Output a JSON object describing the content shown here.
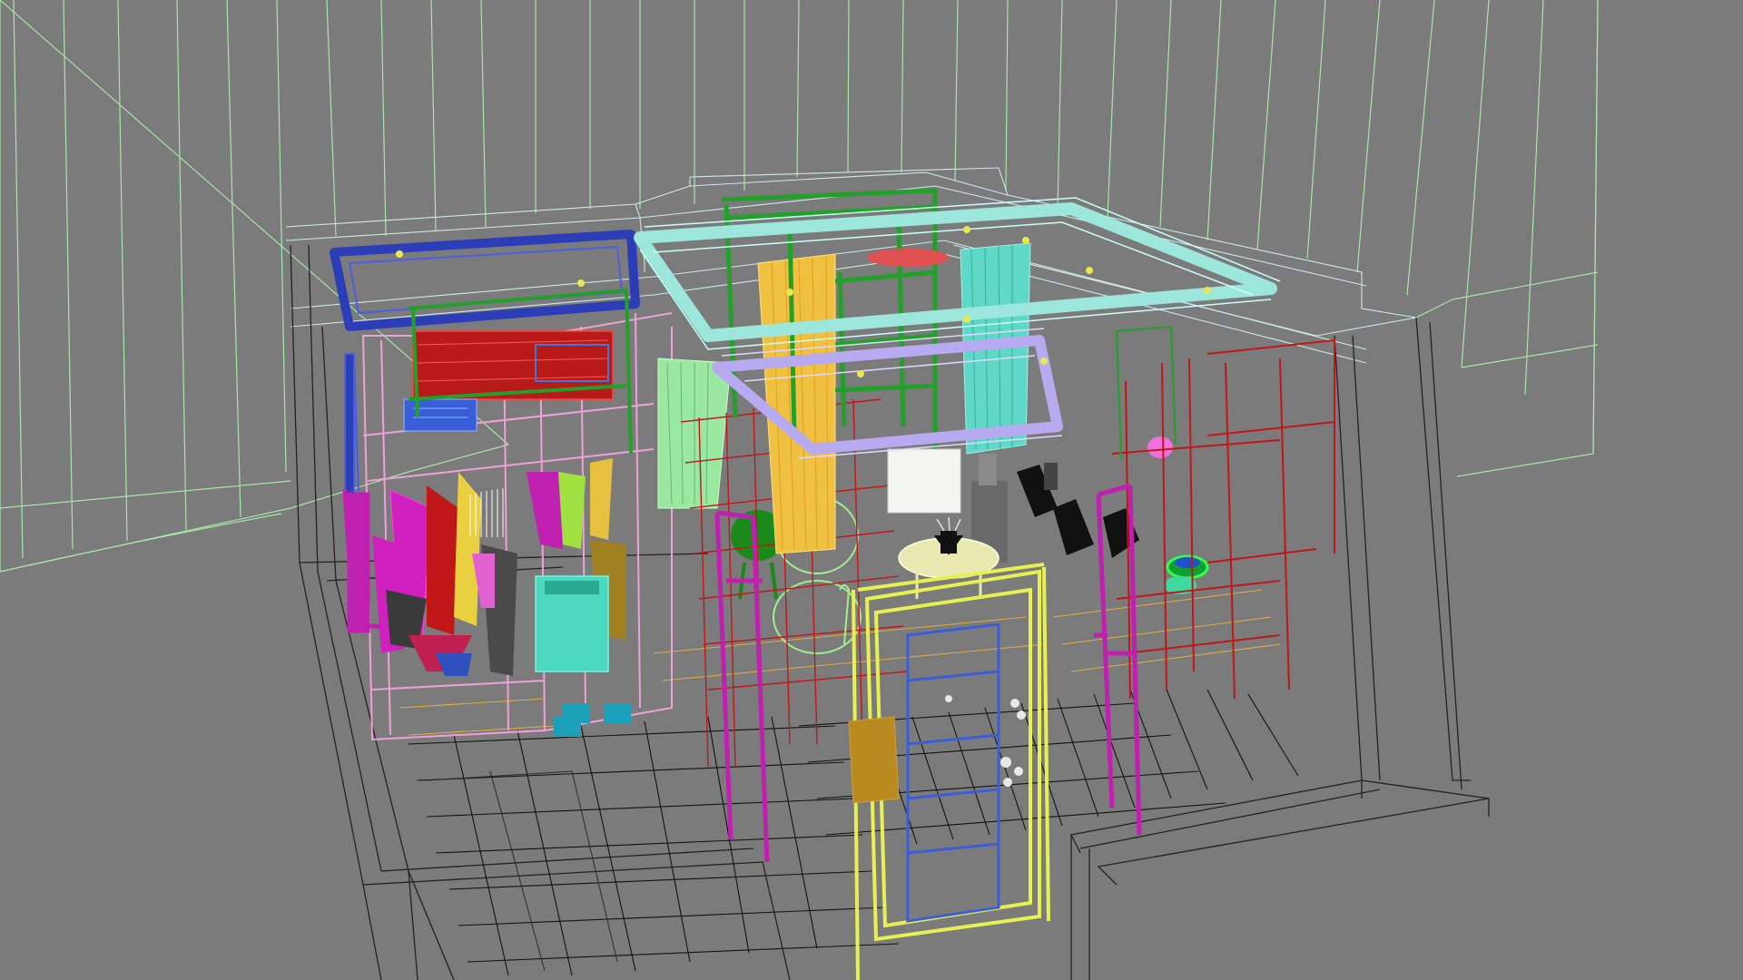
{
  "viewport": {
    "background": "#7b7b7b",
    "grid_color": "#a8e6a6",
    "shell_wire_color": "#1e1e1e",
    "shell_light_color": "#cfd8d8",
    "floor_tile_color": "#141414",
    "object_colors": {
      "ceiling_beam_left": "#2c3db8",
      "ceiling_beam_right": "#9de6dc",
      "ceiling_beam_center": "#b8aaf0",
      "wardrobe_frame": "#f0a0d8",
      "shelf_red": "#c01818",
      "shelf_green": "#22a02a",
      "door_frame": "#e6f050",
      "door_inner": "#3a5ed8",
      "magenta_frame": "#c020b0",
      "curtain_yellow": "#f0c040",
      "curtain_cyan": "#60d8c8",
      "floor_grid_orange": "#e0b040",
      "table_light": "#e8e8b0",
      "plant_green": "#90e890"
    }
  }
}
